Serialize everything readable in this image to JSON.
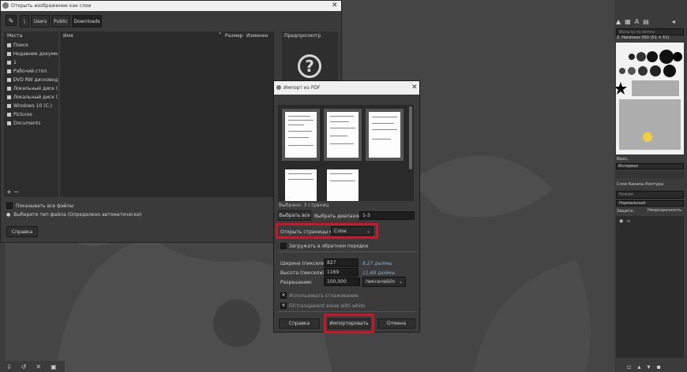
{
  "file_dialog": {
    "title": "Открыть изображение как слои",
    "path_buttons": [
      "\\",
      "Users",
      "Public",
      "Downloads"
    ],
    "places_header": "Места",
    "name_header": "Имя",
    "size_header": "Размер",
    "modified_header": "Изменен",
    "preview_header": "Предпросмотр",
    "places": [
      "Поиск",
      "Недавние докуме...",
      "1",
      "Рабочий стол",
      "DVD RW дисковод...",
      "Локальный диск (...",
      "Локальный диск (...",
      "Windows 10 (C:)",
      "Pictures",
      "Documents"
    ],
    "show_all_files": "Показывать все файлы",
    "file_type_label": "Выберите тип файла (Определено автоматически)",
    "help_button": "Справка"
  },
  "pdf_dialog": {
    "title": "Импорт из PDF",
    "selected_count": "Выбрано: 3 страниц",
    "select_all_button": "Выбрать все",
    "select_range_label": "Выбрать диапазон:",
    "range_value": "1-3",
    "open_pages_label": "Открыть страницы как:",
    "open_pages_value": "Слои",
    "reverse_order_label": "Загружать в обратном порядке",
    "width_label": "Ширина (пиксели):",
    "width_value": "827",
    "width_inches": "8,27 дюймы",
    "height_label": "Высота (пиксели):",
    "height_value": "1169",
    "height_inches": "11,69 дюймы",
    "resolution_label": "Разрешение:",
    "resolution_value": "100,000",
    "resolution_unit": "пикселей/in",
    "antialias_label": "Использовать сглаживание",
    "fill_label": "Fill transparent areas with white",
    "help_button": "Справка",
    "import_button": "Импортировать",
    "cancel_button": "Отмена"
  },
  "right_panel": {
    "filter_placeholder": "Фильтр по метке",
    "brush_name": "2. Hardness 050 (51 × 51)",
    "brush_tag": "Basic,",
    "spacing_label": "Интервал",
    "layer_tabs": "Слои  Каналы  Контуры",
    "mode_label": "Режим",
    "mode_value": "Нормальный",
    "opacity_label": "Непрозрачность",
    "lock_label": "Защита:"
  }
}
